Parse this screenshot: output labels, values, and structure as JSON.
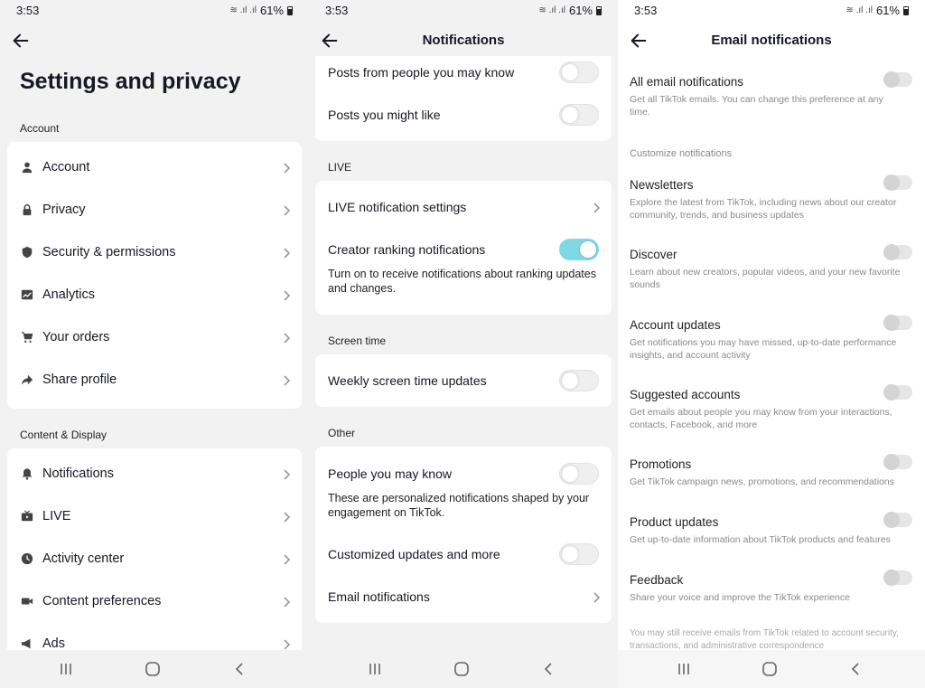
{
  "status": {
    "time": "3:53",
    "battery": "61%",
    "signal_glyph": "≋ .ıl .ıl"
  },
  "panel1": {
    "title": "Settings and privacy",
    "sections": [
      {
        "label": "Account",
        "items": [
          {
            "label": "Account",
            "icon": "person-icon"
          },
          {
            "label": "Privacy",
            "icon": "lock-icon"
          },
          {
            "label": "Security & permissions",
            "icon": "shield-icon"
          },
          {
            "label": "Analytics",
            "icon": "analytics-icon"
          },
          {
            "label": "Your orders",
            "icon": "cart-icon"
          },
          {
            "label": "Share profile",
            "icon": "share-icon"
          }
        ]
      },
      {
        "label": "Content & Display",
        "items": [
          {
            "label": "Notifications",
            "icon": "bell-icon"
          },
          {
            "label": "LIVE",
            "icon": "tv-icon"
          },
          {
            "label": "Activity center",
            "icon": "clock-icon"
          },
          {
            "label": "Content preferences",
            "icon": "video-icon"
          },
          {
            "label": "Ads",
            "icon": "megaphone-icon"
          }
        ]
      }
    ]
  },
  "panel2": {
    "title": "Notifications",
    "top_card": [
      {
        "label": "Posts from people you may know",
        "on": false
      },
      {
        "label": "Posts you might like",
        "on": false
      }
    ],
    "live": {
      "section_label": "LIVE",
      "settings_label": "LIVE notification settings",
      "creator_label": "Creator ranking notifications",
      "creator_desc": "Turn on to receive notifications about ranking updates and changes.",
      "creator_on": true
    },
    "screen_time": {
      "section_label": "Screen time",
      "label": "Weekly screen time updates",
      "on": false
    },
    "other": {
      "section_label": "Other",
      "people_label": "People you may know",
      "people_desc": "These are personalized notifications shaped by your engagement on TikTok.",
      "custom_label": "Customized updates and more",
      "email_label": "Email notifications"
    }
  },
  "panel3": {
    "title": "Email notifications",
    "all": {
      "label": "All email notifications",
      "desc": "Get all TikTok emails. You can change this preference at any time."
    },
    "customize_label": "Customize notifications",
    "items": [
      {
        "label": "Newsletters",
        "desc": "Explore the latest from TikTok, including news about our creator community, trends, and business updates"
      },
      {
        "label": "Discover",
        "desc": "Learn about new creators, popular videos, and your new favorite sounds"
      },
      {
        "label": "Account updates",
        "desc": "Get notifications you may have missed, up-to-date performance insights, and account activity"
      },
      {
        "label": "Suggested accounts",
        "desc": "Get emails about people you may know from your interactions, contacts, Facebook, and more"
      },
      {
        "label": "Promotions",
        "desc": "Get TikTok campaign news, promotions, and recommendations"
      },
      {
        "label": "Product updates",
        "desc": "Get up-to-date information about TikTok products and features"
      },
      {
        "label": "Feedback",
        "desc": "Share your voice and improve the TikTok experience"
      }
    ],
    "footer": "You may still receive emails from TikTok related to account security, transactions, and administrative correspondence"
  },
  "colors": {
    "toggle_on": "#7fd8e3",
    "background": "#f2f2f2",
    "card": "#ffffff"
  }
}
